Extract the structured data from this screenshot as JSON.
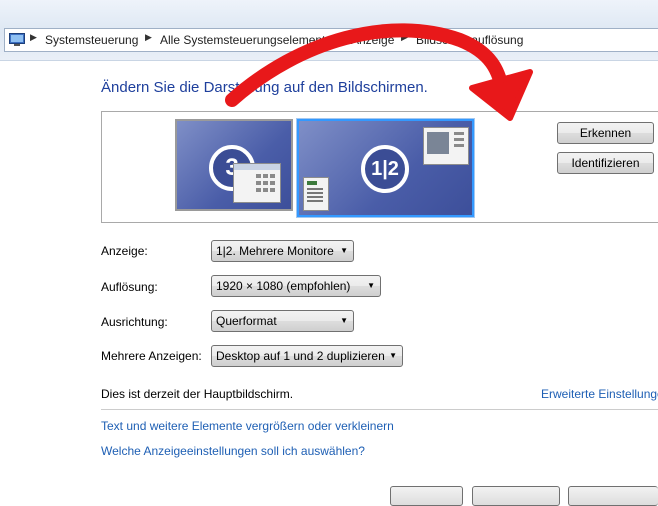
{
  "addressbar": {
    "icon": "control-panel-icon",
    "crumbs": [
      "Systemsteuerung",
      "Alle Systemsteuerungselemente",
      "Anzeige",
      "Bildschirmauflösung"
    ],
    "crumb_separator": "▶"
  },
  "main": {
    "title": "Ändern Sie die Darstellung auf den Bildschirmen.",
    "monitors": {
      "monitor_3_label": "3",
      "monitor_12_label": "1|2"
    },
    "buttons": {
      "detect": "Erkennen",
      "identify": "Identifizieren"
    },
    "settings": {
      "display_label": "Anzeige:",
      "display_value": "1|2. Mehrere Monitore",
      "resolution_label": "Auflösung:",
      "resolution_value": "1920 × 1080 (empfohlen)",
      "orientation_label": "Ausrichtung:",
      "orientation_value": "Querformat",
      "multiple_displays_label": "Mehrere Anzeigen:",
      "multiple_displays_value": "Desktop auf 1 und 2 duplizieren"
    },
    "status": "Dies ist derzeit der Hauptbildschirm.",
    "advanced_link": "Erweiterte Einstellungen",
    "links": [
      "Text und weitere Elemente vergrößern oder verkleinern",
      "Welche Anzeigeeinstellungen soll ich auswählen?"
    ]
  },
  "colors": {
    "title_blue": "#1e3f9c",
    "link_blue": "#1e5fb4",
    "monitor_blue": "#4a5da8",
    "selected_border": "#3399ff",
    "annotation_red": "#e8181a"
  }
}
